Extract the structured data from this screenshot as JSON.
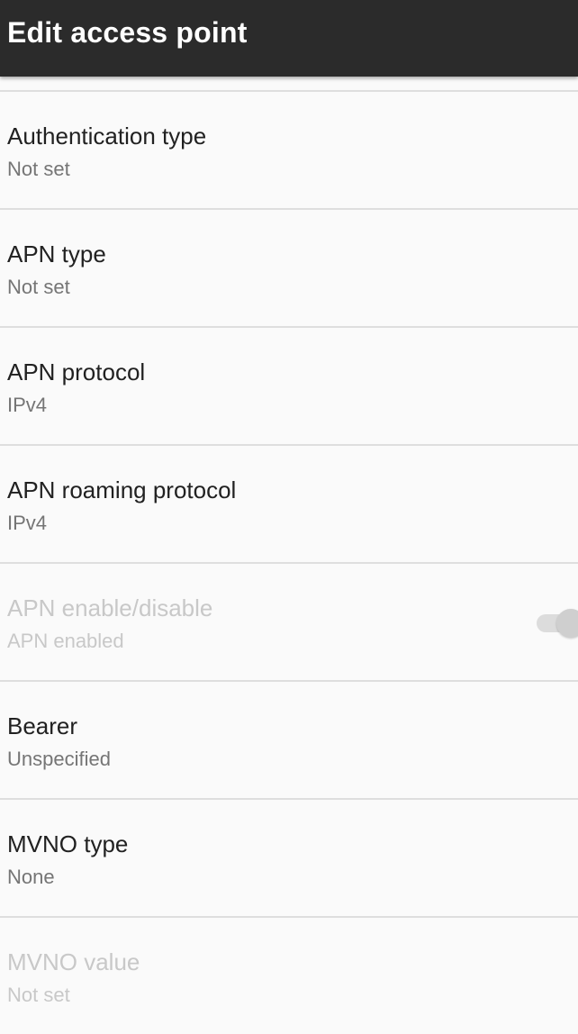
{
  "app_bar": {
    "title": "Edit access point"
  },
  "preferences": [
    {
      "title": "Authentication type",
      "summary": "Not set",
      "enabled": true
    },
    {
      "title": "APN type",
      "summary": "Not set",
      "enabled": true
    },
    {
      "title": "APN protocol",
      "summary": "IPv4",
      "enabled": true
    },
    {
      "title": "APN roaming protocol",
      "summary": "IPv4",
      "enabled": true
    },
    {
      "title": "APN enable/disable",
      "summary": "APN enabled",
      "enabled": false,
      "toggle": "on"
    },
    {
      "title": "Bearer",
      "summary": "Unspecified",
      "enabled": true
    },
    {
      "title": "MVNO type",
      "summary": "None",
      "enabled": true
    },
    {
      "title": "MVNO value",
      "summary": "Not set",
      "enabled": false
    }
  ],
  "colors": {
    "app_bar": "#2b2b2b",
    "background": "#fafafa",
    "divider": "#dedede",
    "title_text": "#212121",
    "summary_text": "#757575",
    "disabled_text": "#c8c8c8"
  }
}
